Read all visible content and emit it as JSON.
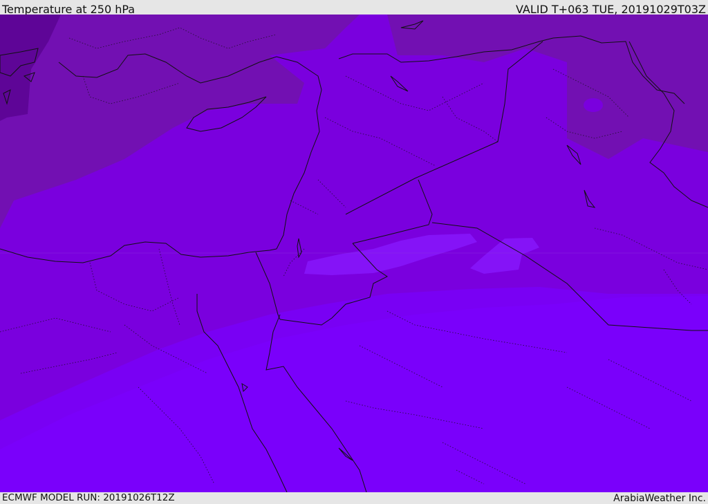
{
  "header": {
    "title": "Temperature at 250 hPa",
    "valid": "VALID T+063 TUE, 20191029T03Z"
  },
  "footer": {
    "model_run": "ECMWF MODEL RUN: 20191026T12Z",
    "credit": "ArabiaWeather Inc."
  },
  "map": {
    "colors": {
      "darkest": "#5e0597",
      "dark": "#7210b2",
      "mid": "#7a00de",
      "light": "#7900f4",
      "lightest": "#7b00ff",
      "patch": "#8a1aff",
      "border": "#111111"
    }
  }
}
